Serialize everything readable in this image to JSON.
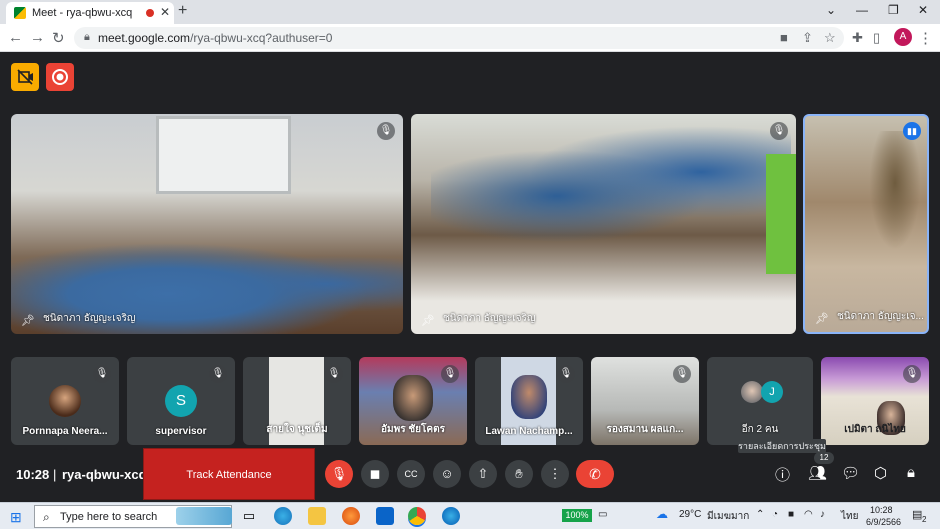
{
  "browser": {
    "tab_title": "Meet - rya-qbwu-xcq",
    "new_tab": "+",
    "url_host": "meet.google.com",
    "url_path": "/rya-qbwu-xcq?authuser=0",
    "profile_initial": "A"
  },
  "meeting": {
    "time": "10:28",
    "code": "rya-qbwu-xcq",
    "track_attendance_label": "Track Attendance",
    "tooltip": "รายละเอียดการประชุม",
    "participant_count": "12"
  },
  "main_tiles": [
    {
      "name": "ชนิดาภา ธัญญะเจริญ"
    },
    {
      "name": "ชนิดาภา ธัญญะเจริญ"
    },
    {
      "name": "ชนิดาภา ธัญญะเจ..."
    }
  ],
  "small_tiles": [
    {
      "name": "Pornnapa Neera..."
    },
    {
      "name": "supervisor",
      "avatar_letter": "S"
    },
    {
      "name": "สายใจ นุชเต็ม"
    },
    {
      "name": "อัมพร ชัยโคตร"
    },
    {
      "name": "Lawan Nachamp..."
    },
    {
      "name": "รองสมาน ผลแก..."
    },
    {
      "name": "อีก 2 คน",
      "avatar_letter": "J"
    },
    {
      "name": "เปมิตา ถนิไทย"
    }
  ],
  "taskbar": {
    "search_placeholder": "Type here to search",
    "battery": "100%",
    "temperature": "29°C",
    "weather": "มีเมฆมาก",
    "lang": "ไทย",
    "clock_time": "10:28",
    "clock_date": "6/9/2566",
    "notifications": "2"
  },
  "colors": {
    "meet_bg": "#202124",
    "end_call": "#ea4335",
    "track_attendance": "#c5221f",
    "active_speaker_border": "#8ab4f8"
  }
}
